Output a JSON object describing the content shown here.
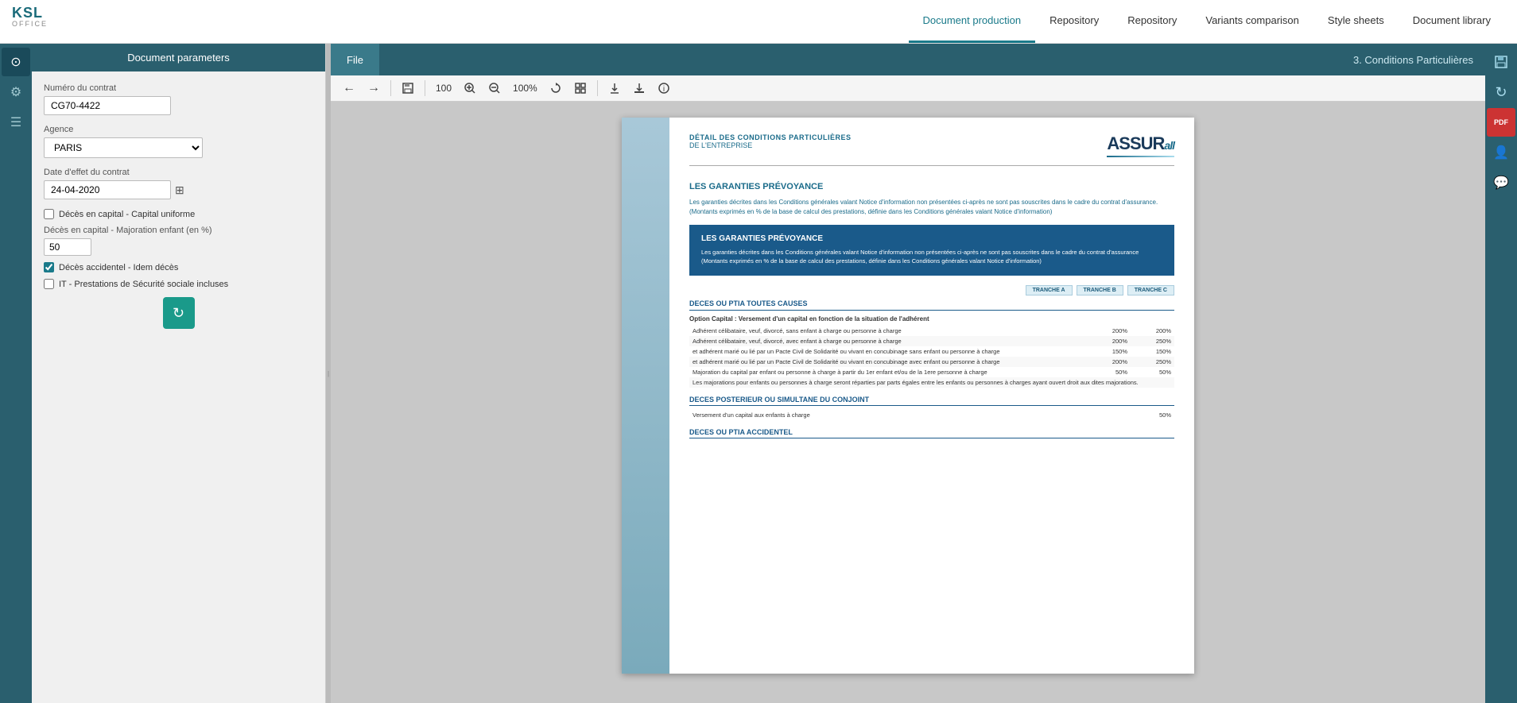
{
  "app": {
    "logo_ksl": "KSL",
    "logo_office": "OFFICE"
  },
  "nav": {
    "items": [
      {
        "label": "Document production",
        "active": true
      },
      {
        "label": "Repository",
        "active": false
      },
      {
        "label": "Repository",
        "active": false
      },
      {
        "label": "Variants comparison",
        "active": false
      },
      {
        "label": "Style sheets",
        "active": false
      },
      {
        "label": "Document library",
        "active": false
      }
    ]
  },
  "sidebar": {
    "icons": [
      {
        "name": "home-icon",
        "symbol": "⊙",
        "active": true
      },
      {
        "name": "settings-icon",
        "symbol": "⚙",
        "active": false
      },
      {
        "name": "list-icon",
        "symbol": "☰",
        "active": false
      }
    ]
  },
  "right_sidebar": {
    "icons": [
      {
        "name": "save-icon",
        "symbol": "💾",
        "active": false
      },
      {
        "name": "refresh-icon",
        "symbol": "↻",
        "active": false
      },
      {
        "name": "pdf-icon",
        "symbol": "PDF",
        "red": true
      },
      {
        "name": "user-icon",
        "symbol": "👤",
        "active": false
      },
      {
        "name": "comment-icon",
        "symbol": "💬",
        "active": false
      }
    ]
  },
  "doc_params": {
    "header": "Document parameters",
    "fields": {
      "contract_label": "Numéro du contrat",
      "contract_value": "CG70-4422",
      "agency_label": "Agence",
      "agency_value": "PARIS",
      "date_label": "Date d'effet du contrat",
      "date_value": "24-04-2020",
      "check1_label": "Décès en capital - Capital uniforme",
      "check1_checked": false,
      "check2_label": "Décès en capital - Majoration enfant (en %)",
      "check2_value": "50",
      "check3_label": "Décès accidentel - Idem décès",
      "check3_checked": true,
      "check4_label": "IT - Prestations de Sécurité sociale incluses",
      "check4_checked": false
    },
    "refresh_label": "↻"
  },
  "content": {
    "tab_label": "File",
    "header_title": "3. Conditions Particulières"
  },
  "toolbar": {
    "back": "←",
    "forward": "→",
    "save": "💾",
    "zoom_100": "100",
    "zoom_in": "🔍+",
    "zoom_out": "🔍-",
    "zoom_display": "100%",
    "rotate": "↻",
    "grid": "⊞",
    "download1": "⬇",
    "download2": "⬇",
    "info": "ℹ"
  },
  "document": {
    "header": {
      "title_main": "DÉTAIL DES CONDITIONS PARTICULIÈRES",
      "title_sub": "DE L'ENTREPRISE",
      "logo_text": "ASSUR",
      "logo_suffix": "all"
    },
    "section1": {
      "title": "LES GARANTIES PRÉVOYANCE",
      "text1": "Les garanties décrites dans les Conditions générales valant Notice d'information non présentées ci-après ne sont pas souscrites dans le cadre du contrat d'assurance.",
      "text2": "(Montants exprimés en % de la base de calcul des prestations, définie dans les Conditions générales valant Notice d'information)"
    },
    "blue_box": {
      "title": "LES GARANTIES PRÉVOYANCE",
      "text": "Les garanties décrites dans les Conditions générales valant Notice d'information non présentées ci-après ne sont pas souscrites dans le cadre du contrat d'assurance (Montants exprimés en % de la base de calcul des prestations, définie dans les Conditions générales valant Notice d'information)"
    },
    "tranches": [
      "TRANCHE A",
      "TRANCHE B",
      "TRANCHE C"
    ],
    "section2": {
      "title": "DECES OU PTIA TOUTES CAUSES",
      "option_title": "Option Capital : Versement d'un capital en fonction de la situation de l'adhérent",
      "rows": [
        {
          "label": "Adhérent célibataire, veuf, divorcé, sans enfant à charge ou personne à charge",
          "a": "200%",
          "b": "200%",
          "c": ""
        },
        {
          "label": "Adhérent célibataire, veuf, divorcé, avec enfant à charge ou personne à charge",
          "a": "200%",
          "b": "250%",
          "c": ""
        },
        {
          "label": "et adhérent marié ou lié par un Pacte Civil de Solidarité ou vivant en concubinage sans enfant ou personne à charge",
          "a": "150%",
          "b": "150%",
          "c": ""
        },
        {
          "label": "et adhérent marié ou lié par un Pacte Civil de Solidarité ou vivant en concubinage avec enfant ou personne à charge",
          "a": "200%",
          "b": "250%",
          "c": ""
        },
        {
          "label": "Majoration du capital par enfant ou personne à charge à partir du 1er enfant et/ou de la 1ere personne à charge",
          "a": "50%",
          "b": "50%",
          "c": ""
        },
        {
          "label": "Les majorations pour enfants ou personnes à charge seront réparties par parts égales entre les enfants ou personnes à charges ayant ouvert droit aux dites majorations.",
          "a": "",
          "b": "",
          "c": ""
        }
      ]
    },
    "section3": {
      "title": "DECES POSTERIEUR OU SIMULTANE DU CONJOINT",
      "rows": [
        {
          "label": "Versement d'un capital aux enfants à charge",
          "a": "50%",
          "b": "",
          "c": ""
        }
      ]
    },
    "section4": {
      "title": "DECES OU PTIA ACCIDENTEL"
    }
  }
}
